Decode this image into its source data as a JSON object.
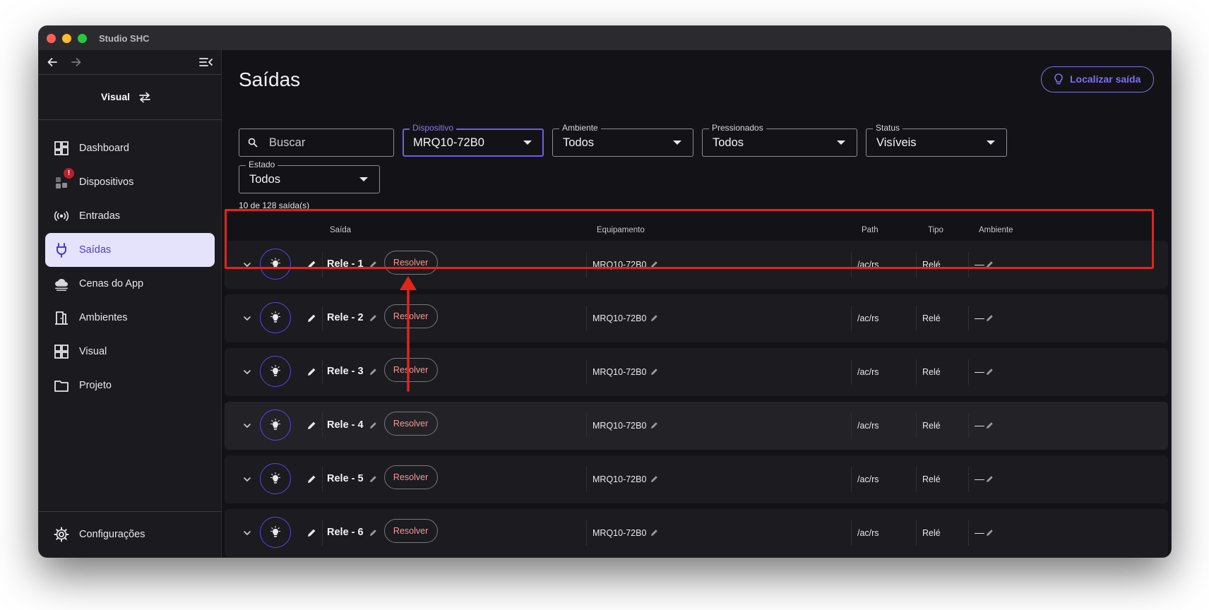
{
  "window": {
    "title": "Studio SHC"
  },
  "sidebar": {
    "mode_label": "Visual",
    "items": [
      {
        "label": "Dashboard",
        "icon": "dashboard-icon"
      },
      {
        "label": "Dispositivos",
        "icon": "devices-icon",
        "badge": "!"
      },
      {
        "label": "Entradas",
        "icon": "signal-icon"
      },
      {
        "label": "Saídas",
        "icon": "plug-icon",
        "active": true
      },
      {
        "label": "Cenas do App",
        "icon": "cloud-icon"
      },
      {
        "label": "Ambientes",
        "icon": "door-icon"
      },
      {
        "label": "Visual",
        "icon": "grid-icon"
      },
      {
        "label": "Projeto",
        "icon": "folder-icon"
      }
    ],
    "settings_label": "Configurações"
  },
  "main": {
    "title": "Saídas",
    "locate_button": "Localizar saída",
    "search_placeholder": "Buscar",
    "filters": {
      "dispositivo": {
        "label": "Dispositivo",
        "value": "MRQ10-72B0"
      },
      "ambiente": {
        "label": "Ambiente",
        "value": "Todos"
      },
      "pressionados": {
        "label": "Pressionados",
        "value": "Todos"
      },
      "status": {
        "label": "Status",
        "value": "Visíveis"
      },
      "estado": {
        "label": "Estado",
        "value": "Todos"
      }
    },
    "count_text": "10 de 128 saída(s)",
    "columns": {
      "saida": "Saída",
      "equipamento": "Equipamento",
      "path": "Path",
      "tipo": "Tipo",
      "ambiente": "Ambiente"
    },
    "rows": [
      {
        "name": "Rele - 1",
        "action": "Resolver",
        "equipamento": "MRQ10-72B0",
        "path": "/ac/rs",
        "tipo": "Relé",
        "ambiente": "—"
      },
      {
        "name": "Rele - 2",
        "action": "Resolver",
        "equipamento": "MRQ10-72B0",
        "path": "/ac/rs",
        "tipo": "Relé",
        "ambiente": "—"
      },
      {
        "name": "Rele - 3",
        "action": "Resolver",
        "equipamento": "MRQ10-72B0",
        "path": "/ac/rs",
        "tipo": "Relé",
        "ambiente": "—"
      },
      {
        "name": "Rele - 4",
        "action": "Resolver",
        "equipamento": "MRQ10-72B0",
        "path": "/ac/rs",
        "tipo": "Relé",
        "ambiente": "—"
      },
      {
        "name": "Rele - 5",
        "action": "Resolver",
        "equipamento": "MRQ10-72B0",
        "path": "/ac/rs",
        "tipo": "Relé",
        "ambiente": "—"
      },
      {
        "name": "Rele - 6",
        "action": "Resolver",
        "equipamento": "MRQ10-72B0",
        "path": "/ac/rs",
        "tipo": "Relé",
        "ambiente": "—"
      }
    ]
  },
  "colors": {
    "accent": "#5a47e0",
    "annotation": "#e3241b",
    "resolve_text": "#f39a95"
  }
}
